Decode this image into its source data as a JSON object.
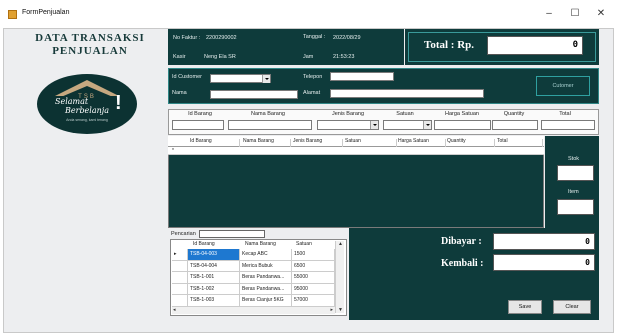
{
  "window": {
    "title": "FormPenjualan",
    "controls": {
      "minimize": "–",
      "maximize": "☐",
      "close": "✕"
    }
  },
  "brand": {
    "title_line1": "DATA TRANSAKSI",
    "title_line2": "PENJUALAN",
    "logo_tsb": "TSB",
    "logo_line1": "Selamat",
    "logo_line2": "Berbelanja",
    "logo_tagline": "Anda senang, kami tenang"
  },
  "info": {
    "faktur_label": "No Faktur :",
    "faktur_value": "2200290002",
    "kasir_label": "Kasir",
    "kasir_value": "Neng Ela SR",
    "tanggal_label": "Tanggal :",
    "tanggal_value": "2022/08/29",
    "jam_label": "Jam",
    "jam_value": "21:53:23"
  },
  "total": {
    "label": "Total : Rp.",
    "value": "0"
  },
  "customer": {
    "id_label": "Id Customer",
    "nama_label": "Nama",
    "telepon_label": "Telepon",
    "alamat_label": "Alamat",
    "button": "Cutomer"
  },
  "entry": {
    "headers": [
      "Id Barang",
      "Nama Barang",
      "Jenis Barang",
      "Satuan",
      "Harga Satuan",
      "Quantity",
      "Total"
    ]
  },
  "grid": {
    "headers": [
      "Id Barang",
      "Nama Barang",
      "Jenis Barang",
      "Satuan",
      "Harga Satuan",
      "Quantity",
      "Total"
    ],
    "row_marker": "*"
  },
  "side": {
    "stok_label": "Stok",
    "item_label": "Item"
  },
  "search": {
    "label": "Pencarian",
    "headers": [
      "Id Barang",
      "Nama Barang",
      "Satuan"
    ],
    "rows": [
      {
        "marker": "▸",
        "id": "TSB-04-003",
        "nama": "Kecap ABC",
        "satuan": "1500",
        "selected": true
      },
      {
        "marker": "",
        "id": "TSB-04-004",
        "nama": "Merica Bubuk",
        "satuan": "6500",
        "selected": false
      },
      {
        "marker": "",
        "id": "TSB-1-001",
        "nama": "Beras Pandanwa...",
        "satuan": "55000",
        "selected": false
      },
      {
        "marker": "",
        "id": "TSB-1-002",
        "nama": "Beras Pandanwa...",
        "satuan": "95000",
        "selected": false
      },
      {
        "marker": "",
        "id": "TSB-1-003",
        "nama": "Beras Cianjur 5KG",
        "satuan": "57000",
        "selected": false
      }
    ]
  },
  "payment": {
    "dibayar_label": "Dibayar :",
    "dibayar_value": "0",
    "kembali_label": "Kembali :",
    "kembali_value": "0"
  },
  "buttons": {
    "save": "Save",
    "clear": "Clear"
  },
  "colors": {
    "panel": "#0e3b3b",
    "accent": "#2fa0a0",
    "selection": "#1e78d0"
  }
}
